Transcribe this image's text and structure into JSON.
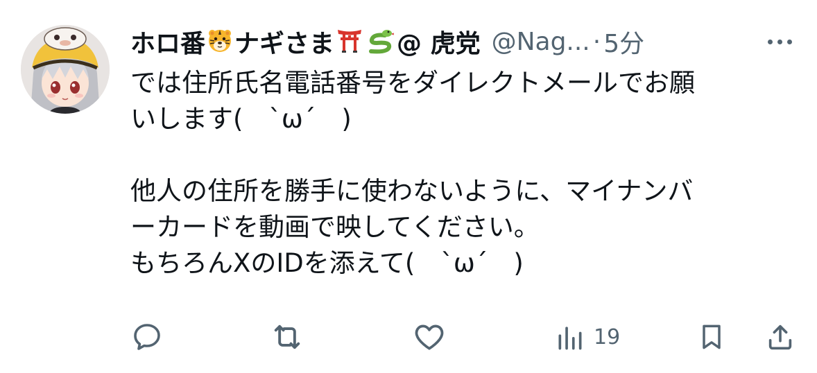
{
  "author": {
    "display_name_prefix": "ホロ番",
    "display_name_middle": "ナギさま",
    "display_name_suffix": "@ 虎党",
    "handle": "@Nag...",
    "separator": "·",
    "time": "5分"
  },
  "tweet": {
    "lines": [
      "では住所氏名電話番号をダイレクトメールでお願",
      "いします(　ˋωˊ　)",
      "",
      "他人の住所を勝手に使わないように、マイナンバ",
      "ーカードを動画で映してください。",
      "もちろんXのIDを添えて(　ˋωˊ　)"
    ]
  },
  "actions": {
    "views_count": "19"
  },
  "icons": {
    "avatar": "anime-avatar-icon",
    "tiger": "tiger-face-emoji",
    "torii": "torii-gate-emoji",
    "snake": "snake-emoji",
    "reply": "reply-icon",
    "retweet": "retweet-icon",
    "like": "heart-icon",
    "views": "views-chart-icon",
    "bookmark": "bookmark-icon",
    "share": "share-icon",
    "more": "more-icon"
  },
  "colors": {
    "text": "#0f1419",
    "secondary": "#536471",
    "background": "#ffffff"
  }
}
